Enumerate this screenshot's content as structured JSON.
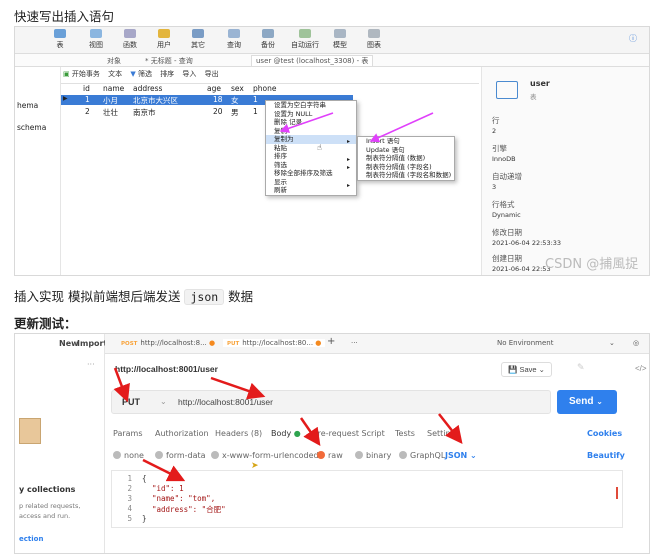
{
  "intro": {
    "line1": "快速写出插入语句",
    "line2_prefix": "插入实现 模拟前端想后端发送",
    "line2_code": "json",
    "line2_suffix": "数据",
    "heading": "更新测试："
  },
  "navicat": {
    "toolbar": [
      "表",
      "视图",
      "函数",
      "用户",
      "其它",
      "查询",
      "备份",
      "自动运行",
      "模型",
      "图表"
    ],
    "tab_objects": "对象",
    "tab_query": "* 无标题 - 查询",
    "tab_table": "user @test (localhost_3308) - 表",
    "left_items": [
      "hema",
      "schema"
    ],
    "actions": [
      "开始事务",
      "文本",
      "筛选",
      "排序",
      "导入",
      "导出"
    ],
    "columns": [
      "id",
      "name",
      "address",
      "age",
      "sex",
      "phone"
    ],
    "rows": [
      [
        "1",
        "小月",
        "北京市大兴区",
        "18",
        "女",
        "1"
      ],
      [
        "2",
        "壮壮",
        "南京市",
        "20",
        "男",
        "1"
      ]
    ],
    "context_menu": [
      "设置为空白字符串",
      "设置为 NULL",
      "删除 记录",
      "复制",
      "复制为",
      "粘贴",
      "排序",
      "筛选",
      "移除全部排序及筛选",
      "显示",
      "刷新"
    ],
    "submenu": [
      "Insert 语句",
      "Update 语句",
      "制表符分隔值 (数据)",
      "制表符分隔值 (字段名)",
      "制表符分隔值 (字段名和数据)"
    ],
    "right_panel": {
      "table_name": "user",
      "table_sub": "表",
      "props": [
        {
          "label": "行",
          "value": "2"
        },
        {
          "label": "引擎",
          "value": "InnoDB"
        },
        {
          "label": "自动递增",
          "value": "3"
        },
        {
          "label": "行格式",
          "value": "Dynamic"
        },
        {
          "label": "修改日期",
          "value": "2021-06-04 22:53:33"
        },
        {
          "label": "创建日期",
          "value": "2021-06-04 22:53"
        }
      ]
    },
    "watermark": "CSDN @捕風捉影"
  },
  "postman": {
    "left": {
      "new": "New",
      "import": "Import",
      "collections": "y collections",
      "desc1": "p related requests,",
      "desc2": "access and run.",
      "link": "ection"
    },
    "tabs": [
      {
        "method": "POST",
        "url": "http://localhost:8..."
      },
      {
        "method": "PUT",
        "url": "http://localhost:80..."
      }
    ],
    "no_env": "No Environment",
    "request_name": "http://localhost:8001/user",
    "save": "Save",
    "method": "PUT",
    "url": "http://localhost:8001/user",
    "send": "Send",
    "subtabs": [
      "Params",
      "Authorization",
      "Headers (8)",
      "Body",
      "Pre-request Script",
      "Tests",
      "Settings"
    ],
    "cookies": "Cookies",
    "body_types": [
      "none",
      "form-data",
      "x-www-form-urlencoded",
      "raw",
      "binary",
      "GraphQL"
    ],
    "format": "JSON",
    "beautify": "Beautify",
    "code_lines": [
      "{",
      "\"id\": 1",
      "\"name\": \"tom\",",
      "\"address\": \"合肥\"",
      "}"
    ],
    "line_numbers": [
      "1",
      "2",
      "3",
      "4",
      "5"
    ]
  }
}
